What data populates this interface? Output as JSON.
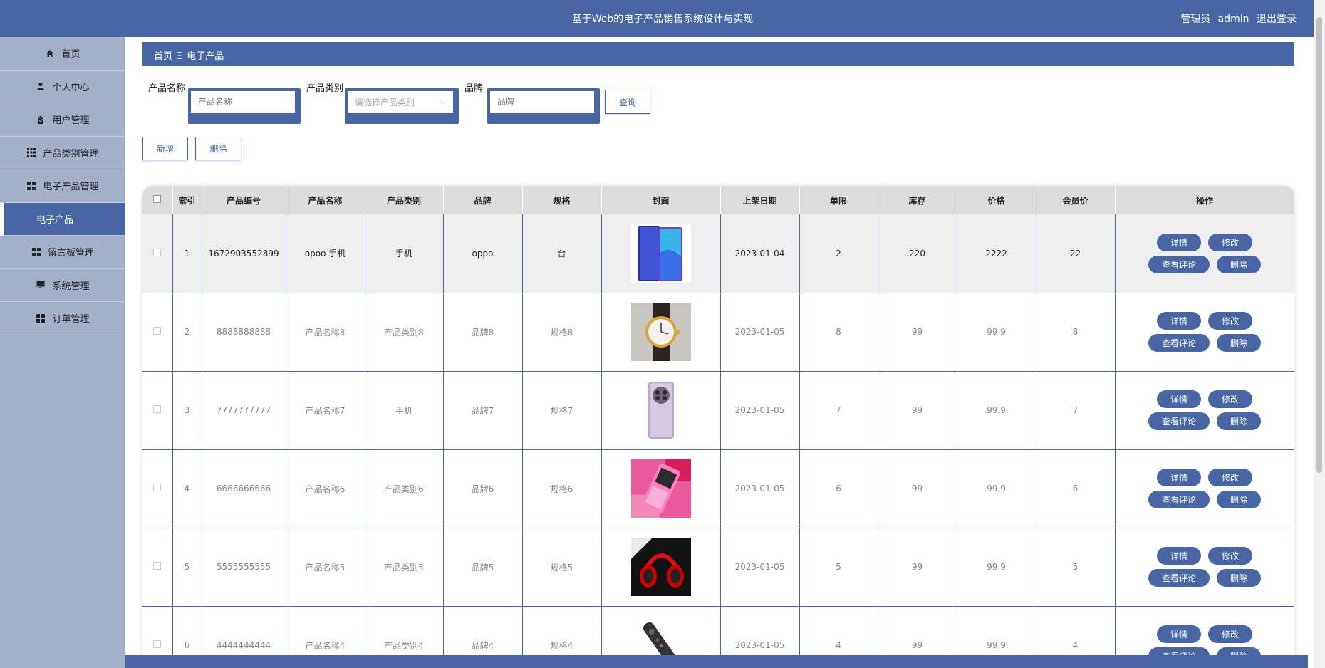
{
  "app": {
    "title": "基于Web的电子产品销售系统设计与实现",
    "role": "管理员",
    "username": "admin",
    "logout_label": "退出登录"
  },
  "sidebar": {
    "items": [
      {
        "label": "首页",
        "icon": "home-icon"
      },
      {
        "label": "个人中心",
        "icon": "user-icon"
      },
      {
        "label": "用户管理",
        "icon": "clipboard-icon"
      },
      {
        "label": "产品类别管理",
        "icon": "grid9-icon"
      },
      {
        "label": "电子产品管理",
        "icon": "grid4-icon"
      },
      {
        "label": "电子产品",
        "icon": ""
      },
      {
        "label": "留言板管理",
        "icon": "grid4-icon"
      },
      {
        "label": "系统管理",
        "icon": "monitor-icon"
      },
      {
        "label": "订单管理",
        "icon": "grid4-icon"
      }
    ]
  },
  "breadcrumb": {
    "home": "首页",
    "sep": "Ξ",
    "current": "电子产品"
  },
  "search": {
    "name_label": "产品名称",
    "name_placeholder": "产品名称",
    "category_label": "产品类别",
    "category_placeholder": "请选择产品类别",
    "brand_label": "品牌",
    "brand_placeholder": "品牌",
    "query_label": "查询"
  },
  "actions": {
    "add_label": "新增",
    "delete_label": "删除"
  },
  "table": {
    "headers": [
      "索引",
      "产品编号",
      "产品名称",
      "产品类别",
      "品牌",
      "规格",
      "封面",
      "上架日期",
      "单限",
      "库存",
      "价格",
      "会员价",
      "操作"
    ],
    "op_labels": {
      "detail": "详情",
      "edit": "修改",
      "comments": "查看评论",
      "delete": "删除"
    },
    "rows": [
      {
        "index": "1",
        "code": "1672903552899",
        "name": "opoo 手机",
        "category": "手机",
        "brand": "oppo",
        "spec": "台",
        "cover": "phone-blue-image",
        "date": "2023-01-04",
        "limit": "2",
        "stock": "220",
        "price": "2222",
        "member_price": "22"
      },
      {
        "index": "2",
        "code": "8888888888",
        "name": "产品名称8",
        "category": "产品类别8",
        "brand": "品牌8",
        "spec": "规格8",
        "cover": "watch-image",
        "date": "2023-01-05",
        "limit": "8",
        "stock": "99",
        "price": "99.9",
        "member_price": "8"
      },
      {
        "index": "3",
        "code": "7777777777",
        "name": "产品名称7",
        "category": "手机",
        "brand": "品牌7",
        "spec": "规格7",
        "cover": "phone-purple-image",
        "date": "2023-01-05",
        "limit": "7",
        "stock": "99",
        "price": "99.9",
        "member_price": "7"
      },
      {
        "index": "4",
        "code": "6666666666",
        "name": "产品名称6",
        "category": "产品类别6",
        "brand": "品牌6",
        "spec": "规格6",
        "cover": "pink-phone-image",
        "date": "2023-01-05",
        "limit": "6",
        "stock": "99",
        "price": "99.9",
        "member_price": "6"
      },
      {
        "index": "5",
        "code": "5555555555",
        "name": "产品名称5",
        "category": "产品类别5",
        "brand": "品牌5",
        "spec": "规格5",
        "cover": "headphones-image",
        "date": "2023-01-05",
        "limit": "5",
        "stock": "99",
        "price": "99.9",
        "member_price": "5"
      },
      {
        "index": "6",
        "code": "4444444444",
        "name": "产品名称4",
        "category": "产品类别4",
        "brand": "品牌4",
        "spec": "规格4",
        "cover": "remote-image",
        "date": "2023-01-05",
        "limit": "4",
        "stock": "99",
        "price": "99.9",
        "member_price": "4"
      }
    ]
  },
  "colors": {
    "primary": "#4766a3",
    "sidebar": "#a4afc8",
    "header_cell": "#dcdcdc"
  }
}
